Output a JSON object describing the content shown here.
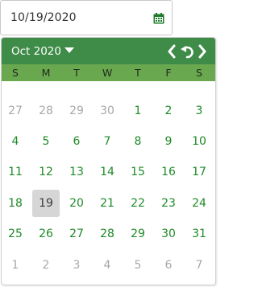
{
  "date_input": {
    "value": "10/19/2020"
  },
  "calendar": {
    "month_title": "Oct 2020",
    "weekdays": [
      "S",
      "M",
      "T",
      "W",
      "T",
      "F",
      "S"
    ],
    "weeks": [
      [
        {
          "d": "27",
          "other": true
        },
        {
          "d": "28",
          "other": true
        },
        {
          "d": "29",
          "other": true
        },
        {
          "d": "30",
          "other": true
        },
        {
          "d": "1"
        },
        {
          "d": "2"
        },
        {
          "d": "3"
        }
      ],
      [
        {
          "d": "4"
        },
        {
          "d": "5"
        },
        {
          "d": "6"
        },
        {
          "d": "7"
        },
        {
          "d": "8"
        },
        {
          "d": "9"
        },
        {
          "d": "10"
        }
      ],
      [
        {
          "d": "11"
        },
        {
          "d": "12"
        },
        {
          "d": "13"
        },
        {
          "d": "14"
        },
        {
          "d": "15"
        },
        {
          "d": "16"
        },
        {
          "d": "17"
        }
      ],
      [
        {
          "d": "18"
        },
        {
          "d": "19",
          "selected": true
        },
        {
          "d": "20"
        },
        {
          "d": "21"
        },
        {
          "d": "22"
        },
        {
          "d": "23"
        },
        {
          "d": "24"
        }
      ],
      [
        {
          "d": "25"
        },
        {
          "d": "26"
        },
        {
          "d": "27"
        },
        {
          "d": "28"
        },
        {
          "d": "29"
        },
        {
          "d": "30"
        },
        {
          "d": "31"
        }
      ],
      [
        {
          "d": "1",
          "other": true
        },
        {
          "d": "2",
          "other": true
        },
        {
          "d": "3",
          "other": true
        },
        {
          "d": "4",
          "other": true
        },
        {
          "d": "5",
          "other": true
        },
        {
          "d": "6",
          "other": true
        },
        {
          "d": "7",
          "other": true
        }
      ]
    ]
  },
  "icons": {
    "calendar_button": "calendar-icon",
    "month_dropdown": "caret-down-icon",
    "prev": "chevron-left-icon",
    "today": "undo-icon",
    "next": "chevron-right-icon"
  },
  "colors": {
    "header": "#3f8b48",
    "weekday_bar": "#6aa84f",
    "day_text": "#1e8a27",
    "other_month_text": "#a8a8a8",
    "selected_bg": "#d6d6d6"
  }
}
